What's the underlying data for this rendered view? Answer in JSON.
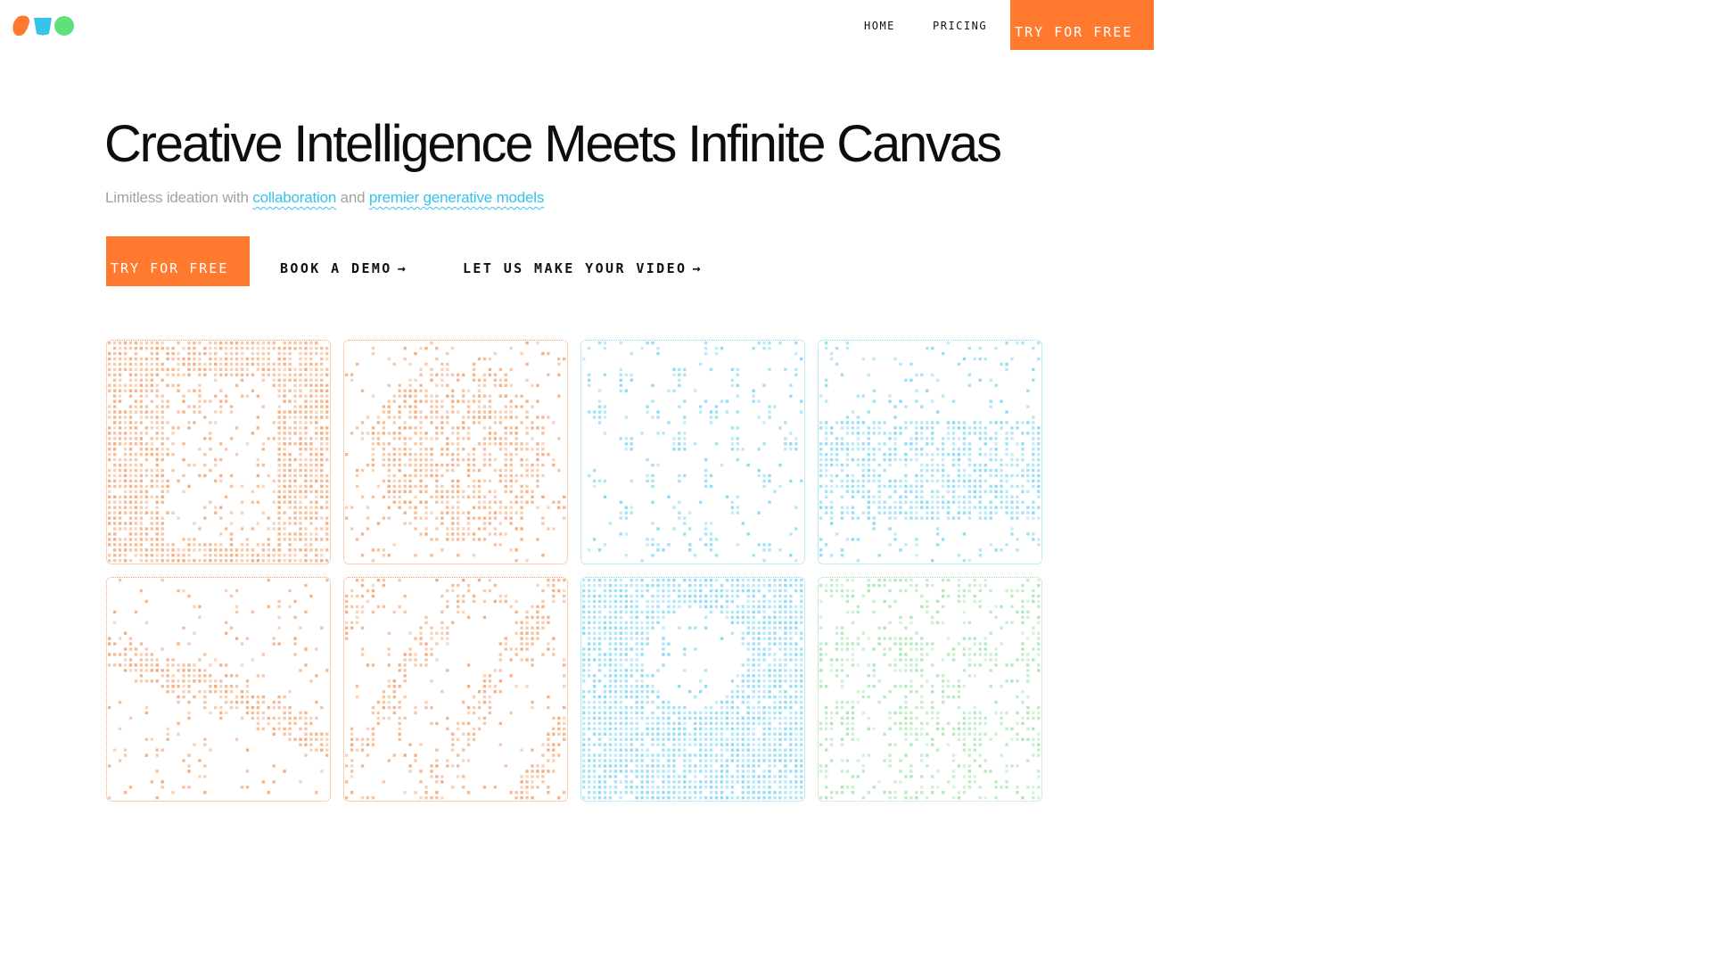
{
  "logo": {
    "shapes": [
      "orange-blob",
      "blue-cup",
      "green-blob"
    ],
    "colors": [
      "#ff7a2f",
      "#36c3ea",
      "#5fe07a"
    ]
  },
  "nav": {
    "home_label": "HOME",
    "pricing_label": "PRICING",
    "cta_label": "TRY FOR FREE"
  },
  "hero": {
    "title": "Creative Intelligence Meets Infinite Canvas",
    "subtitle_prefix": "Limitless ideation with ",
    "subtitle_link1": "collaboration",
    "subtitle_mid": " and ",
    "subtitle_link2": "premier generative models"
  },
  "ctas": {
    "primary_label": "TRY FOR FREE",
    "demo_label": "BOOK A DEMO",
    "video_label": "LET US MAKE YOUR VIDEO",
    "arrow_icon": "arrow-right-icon"
  },
  "colors": {
    "accent": "#ff7a2f",
    "link": "#36c3ea",
    "tile_orange": "#f2a878",
    "tile_blue": "#86d8f2",
    "tile_green": "#a8e6b0"
  },
  "gallery": {
    "tiles": [
      {
        "name": "pixel-character",
        "color": "orange"
      },
      {
        "name": "pixel-sphere",
        "color": "orange"
      },
      {
        "name": "pixel-splash",
        "color": "blue"
      },
      {
        "name": "pixel-landscape",
        "color": "blue"
      },
      {
        "name": "pixel-streak",
        "color": "orange"
      },
      {
        "name": "pixel-scatter",
        "color": "orange"
      },
      {
        "name": "pixel-figure",
        "color": "blue"
      },
      {
        "name": "pixel-foliage",
        "color": "green"
      }
    ]
  }
}
